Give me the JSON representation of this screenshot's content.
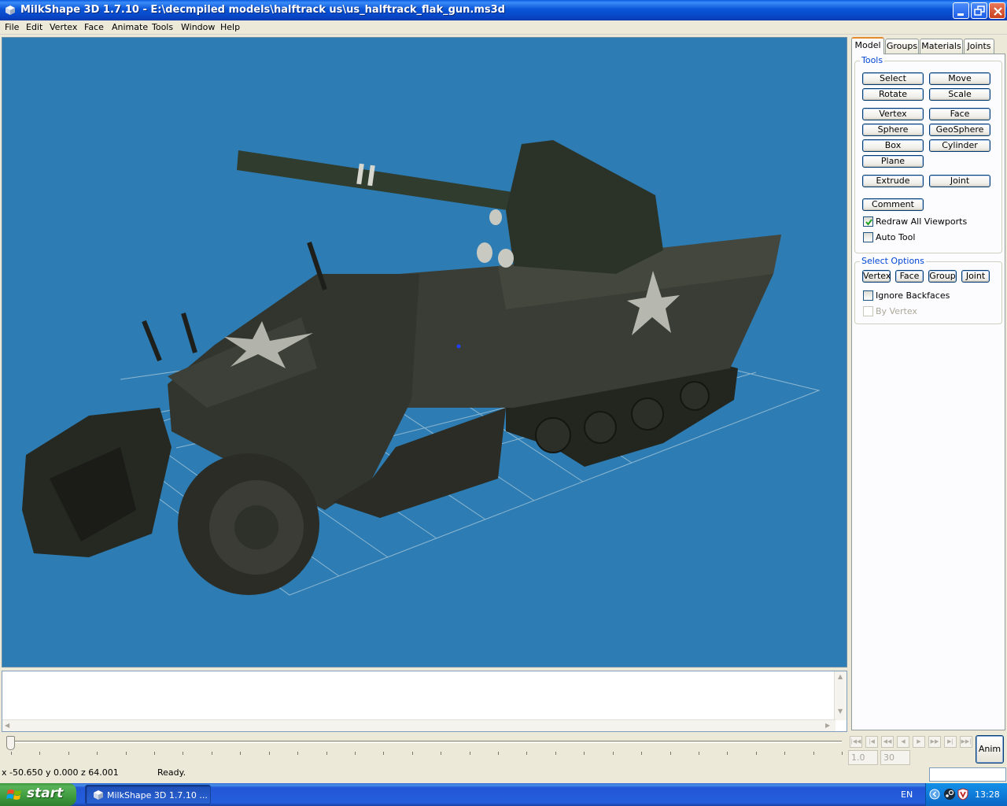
{
  "window": {
    "title": "MilkShape 3D 1.7.10 - E:\\decmpiled models\\halftrack us\\us_halftrack_flak_gun.ms3d",
    "minimize_icon": "minimize-icon",
    "maximize_icon": "restore-icon",
    "close_icon": "close-icon"
  },
  "menu": [
    "File",
    "Edit",
    "Vertex",
    "Face",
    "Animate",
    "Tools",
    "Window",
    "Help"
  ],
  "panel": {
    "tabs": [
      "Model",
      "Groups",
      "Materials",
      "Joints"
    ],
    "active_tab": "Model",
    "tools_title": "Tools",
    "tools": {
      "select": "Select",
      "move": "Move",
      "rotate": "Rotate",
      "scale": "Scale",
      "vertex": "Vertex",
      "face": "Face",
      "sphere": "Sphere",
      "geosphere": "GeoSphere",
      "box": "Box",
      "cylinder": "Cylinder",
      "plane": "Plane",
      "extrude": "Extrude",
      "joint": "Joint",
      "comment": "Comment"
    },
    "redraw_all_viewports": {
      "label": "Redraw All Viewports",
      "checked": true
    },
    "auto_tool": {
      "label": "Auto Tool",
      "checked": false
    },
    "select_options_title": "Select Options",
    "select_options": {
      "vertex": "Vertex",
      "face": "Face",
      "group": "Group",
      "joint": "Joint"
    },
    "ignore_backfaces": {
      "label": "Ignore Backfaces",
      "checked": false
    },
    "by_vertex": {
      "label": "By Vertex",
      "checked": false,
      "enabled": false
    }
  },
  "animation": {
    "frame_start": "1.0",
    "frame_end": "30",
    "anim_label": "Anim",
    "slider_position": 0
  },
  "status": {
    "coords": "x -50.650 y 0.000 z 64.001",
    "message": "Ready."
  },
  "taskbar": {
    "start_label": "start",
    "task_item": "MilkShape 3D 1.7.10 ...",
    "language": "EN",
    "clock": "13:28"
  },
  "colors": {
    "viewport_bg": "#2d7db4",
    "grid": "#9ec1d6",
    "model": "#2e312a"
  }
}
